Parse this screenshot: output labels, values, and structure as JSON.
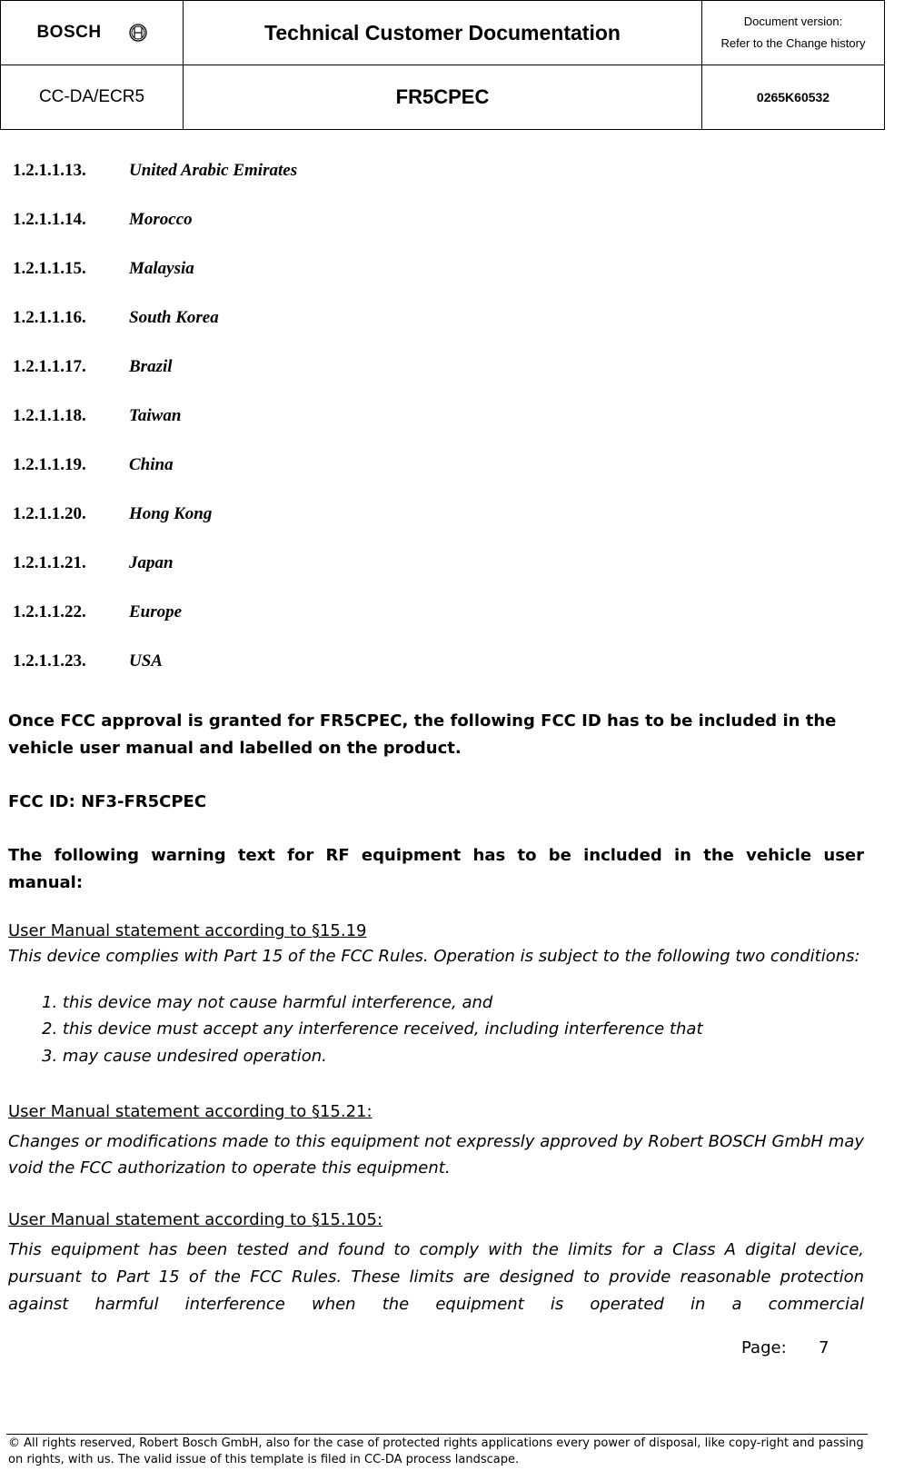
{
  "header": {
    "logo_text": "BOSCH",
    "logo_icon": "bosch-armature-icon",
    "title": "Technical Customer Documentation",
    "version_label": "Document version:",
    "version_value": "Refer to the Change history",
    "department": "CC-DA/ECR5",
    "product": "FR5CPEC",
    "document_number": "0265K60532"
  },
  "headings": [
    {
      "number": "1.2.1.1.13.",
      "name": "United Arabic Emirates"
    },
    {
      "number": "1.2.1.1.14.",
      "name": "Morocco"
    },
    {
      "number": "1.2.1.1.15.",
      "name": "Malaysia"
    },
    {
      "number": "1.2.1.1.16.",
      "name": "South Korea"
    },
    {
      "number": "1.2.1.1.17.",
      "name": "Brazil"
    },
    {
      "number": "1.2.1.1.18.",
      "name": "Taiwan"
    },
    {
      "number": "1.2.1.1.19.",
      "name": "China"
    },
    {
      "number": "1.2.1.1.20.",
      "name": "Hong Kong"
    },
    {
      "number": "1.2.1.1.21.",
      "name": "Japan"
    },
    {
      "number": "1.2.1.1.22.",
      "name": "Europe"
    },
    {
      "number": "1.2.1.1.23.",
      "name": "USA"
    }
  ],
  "body": {
    "fcc_intro": "Once FCC approval is granted for FR5CPEC, the following FCC ID has to be included in the vehicle user manual and labelled on the product.",
    "fcc_id": "FCC ID: NF3-FR5CPEC",
    "warning_intro": "The following warning text for RF equipment has to be included in the vehicle user manual:",
    "statement_1519": {
      "title": "User Manual statement according to §15.19",
      "text": "This device complies with Part 15 of the FCC Rules. Operation is subject to the following two conditions:",
      "items": [
        {
          "marker": "1.",
          "text": "this device may not cause harmful interference, and"
        },
        {
          "marker": "2.",
          "text": "this device must accept any interference received, including interference that"
        },
        {
          "marker": "3.",
          "text": "may cause undesired operation."
        }
      ]
    },
    "statement_1521": {
      "title": "User Manual statement according to §15.21:",
      "text": "Changes or modifications made to this equipment not expressly approved by Robert BOSCH GmbH may void the FCC authorization to operate this equipment."
    },
    "statement_15105": {
      "title": "User Manual statement according to §15.105:",
      "text": "This equipment has been tested and found to comply with the limits for a Class A digital device, pursuant to Part 15 of the FCC Rules. These limits are designed to provide reasonable protection against harmful interference when the equipment is operated in a commercial"
    }
  },
  "page": {
    "label": "Page:",
    "number": "7"
  },
  "footer": {
    "copyright": "© All rights reserved, Robert Bosch GmbH, also for the case of protected rights applications every power of disposal, like copy-right and passing on rights, with us. The valid issue of this template is filed in CC-DA process landscape."
  }
}
